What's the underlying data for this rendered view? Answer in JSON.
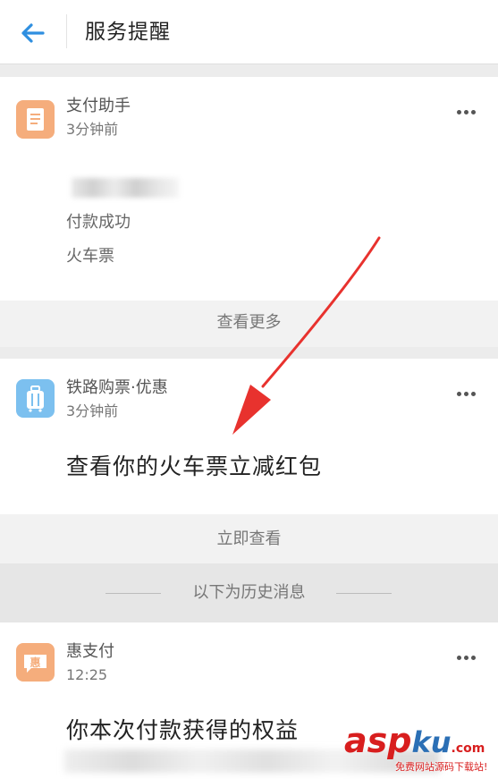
{
  "header": {
    "title": "服务提醒"
  },
  "messages": [
    {
      "app_name": "支付助手",
      "time": "3分钟前",
      "lines": [
        "付款成功",
        "火车票"
      ],
      "action": "查看更多"
    },
    {
      "app_name": "铁路购票·优惠",
      "time": "3分钟前",
      "title": "查看你的火车票立减红包",
      "action": "立即查看"
    }
  ],
  "history": {
    "label": "以下为历史消息"
  },
  "history_messages": [
    {
      "app_name": "惠支付",
      "time": "12:25",
      "title": "你本次付款获得的权益"
    }
  ],
  "watermark": {
    "brand_part1": "asp",
    "brand_part2": "ku",
    "brand_part3": ".com",
    "tagline": "免费网站源码下载站!"
  },
  "colors": {
    "accent_blue": "#2f8fe0",
    "alipay_orange": "#f5ad7c",
    "rail_blue": "#7cc0ef",
    "annotation_red": "#e8322e"
  }
}
